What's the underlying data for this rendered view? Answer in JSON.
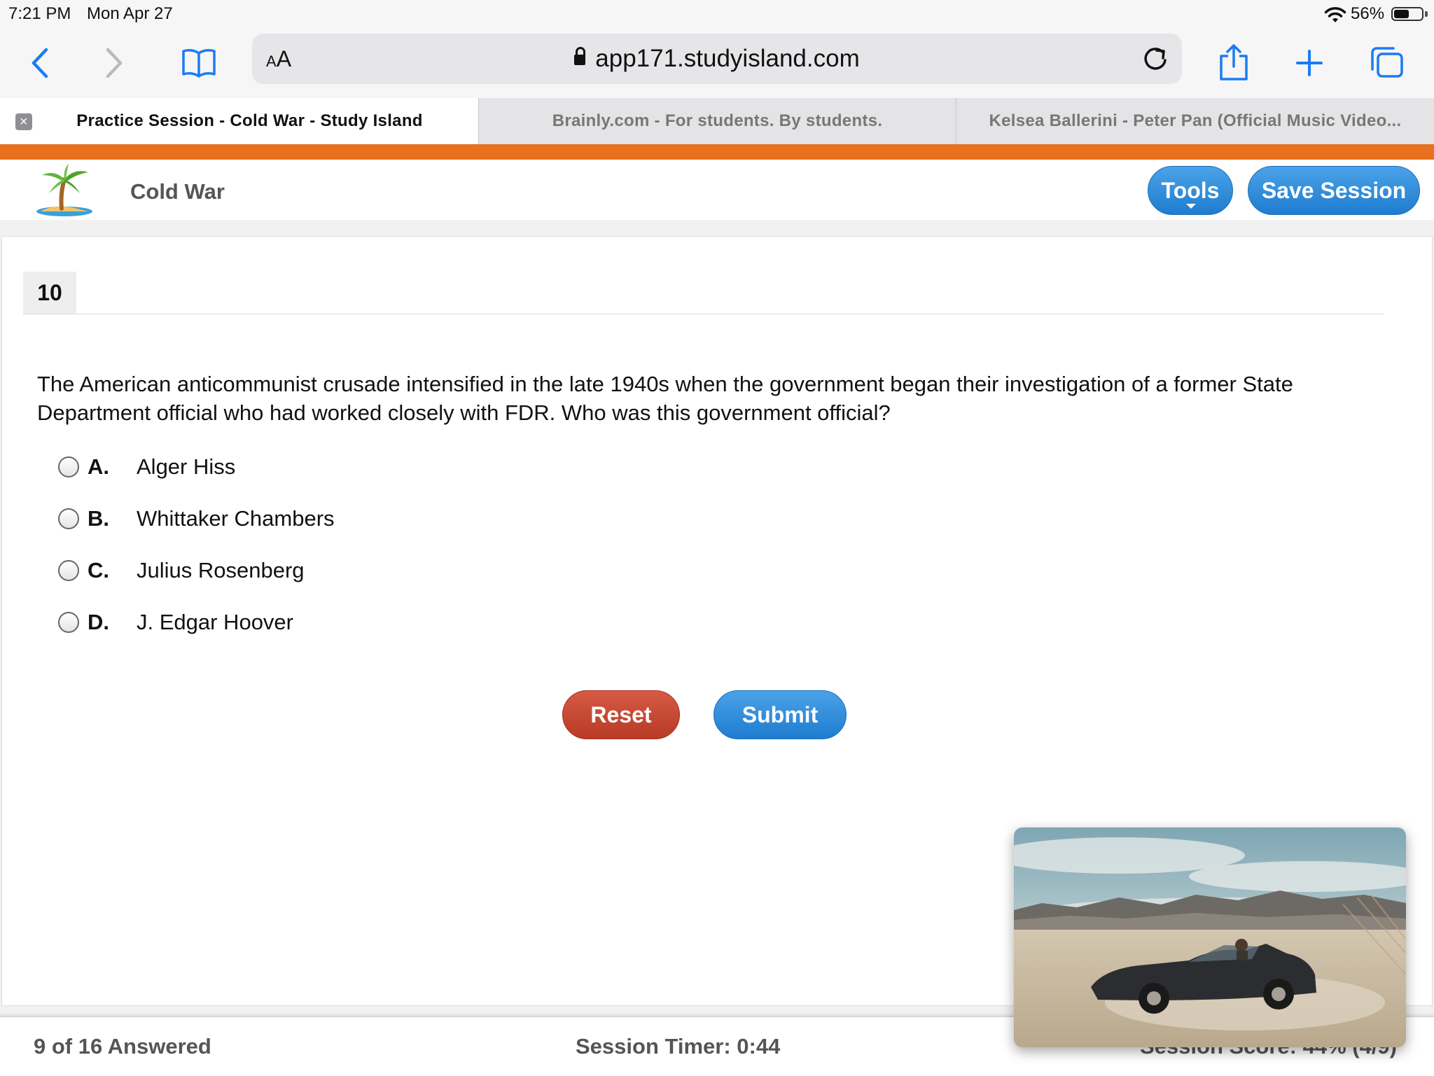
{
  "status_bar": {
    "time": "7:21 PM",
    "date": "Mon Apr 27",
    "battery_percent_label": "56%",
    "battery_level": 0.56
  },
  "browser": {
    "text_size_label_small": "A",
    "text_size_label_large": "A",
    "url": "app171.studyisland.com",
    "accent_color": "#1a7cf3",
    "tabs": [
      {
        "title": "Practice Session - Cold War - Study Island",
        "active": true
      },
      {
        "title": "Brainly.com - For students. By students.",
        "active": false
      },
      {
        "title": "Kelsea Ballerini - Peter Pan (Official Music Video...",
        "active": false
      }
    ]
  },
  "app": {
    "brand_orange": "#e8701f",
    "topic": "Cold War",
    "tools_label": "Tools",
    "save_label": "Save Session"
  },
  "question": {
    "number": "10",
    "text": "The American anticommunist crusade intensified in the late 1940s when the government began their investigation of a former State Department official who had worked closely with FDR. Who was this government official?",
    "choices": [
      {
        "letter": "A.",
        "text": "Alger Hiss"
      },
      {
        "letter": "B.",
        "text": "Whittaker Chambers"
      },
      {
        "letter": "C.",
        "text": "Julius Rosenberg"
      },
      {
        "letter": "D.",
        "text": "J. Edgar Hoover"
      }
    ],
    "reset_label": "Reset",
    "submit_label": "Submit"
  },
  "footer": {
    "answered": "9 of 16 Answered",
    "timer": "Session Timer: 0:44",
    "score": "Session Score: 44% (4/9)"
  },
  "icons": {
    "back": "chevron-left-icon",
    "forward": "chevron-right-icon",
    "bookmarks": "book-icon",
    "reload": "reload-icon",
    "share": "share-icon",
    "new_tab": "plus-icon",
    "tabs": "tabs-icon",
    "close_tab": "close-icon"
  }
}
